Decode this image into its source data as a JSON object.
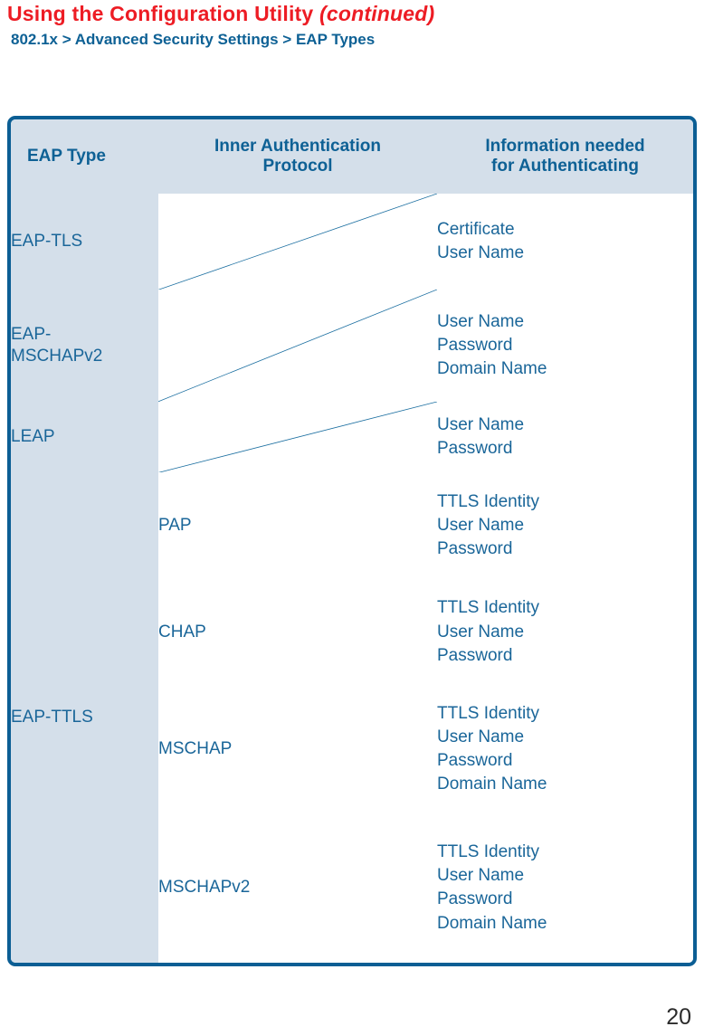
{
  "header": {
    "title_main": "Using the Configuration Utility",
    "title_continued": "(continued)",
    "subtitle": "802.1x > Advanced Security Settings > EAP Types",
    "title_color": "#ED1C24",
    "subtitle_color": "#0E6195"
  },
  "table": {
    "columns": [
      "EAP Type",
      "Inner Authentication Protocol",
      "Information needed for Authenticating"
    ],
    "columns_display": {
      "col1": "EAP Type",
      "col2_line1": "Inner Authentication",
      "col2_line2": "Protocol",
      "col3_line1": "Information needed",
      "col3_line2": "for Authenticating"
    },
    "border_color": "#0B5E94",
    "header_fill": "#D4DFEA",
    "left_cell_fill": "#D4DFEA",
    "text_color": "#1A6699",
    "rows": [
      {
        "eap_type_lines": [
          "EAP-TLS"
        ],
        "inner_protocol": "",
        "inner_protocol_na": true,
        "info": [
          "Certificate",
          "User Name"
        ]
      },
      {
        "eap_type_lines": [
          "EAP-",
          "MSCHAPv2"
        ],
        "inner_protocol": "",
        "inner_protocol_na": true,
        "info": [
          "User Name",
          "Password",
          "Domain Name"
        ]
      },
      {
        "eap_type_lines": [
          "LEAP"
        ],
        "inner_protocol": "",
        "inner_protocol_na": true,
        "info": [
          "User Name",
          "Password"
        ]
      },
      {
        "eap_type_lines": [
          "EAP-TTLS"
        ],
        "eap_type_rowspan": 4,
        "inner_protocol": "PAP",
        "inner_protocol_na": false,
        "info": [
          "TTLS Identity",
          "User Name",
          "Password"
        ]
      },
      {
        "inner_protocol": "CHAP",
        "inner_protocol_na": false,
        "info": [
          "TTLS Identity",
          "User Name",
          "Password"
        ]
      },
      {
        "inner_protocol": "MSCHAP",
        "inner_protocol_na": false,
        "info": [
          "TTLS Identity",
          "User Name",
          "Password",
          "Domain Name"
        ]
      },
      {
        "inner_protocol": "MSCHAPv2",
        "inner_protocol_na": false,
        "info": [
          "TTLS Identity",
          "User Name",
          "Password",
          "Domain Name"
        ]
      }
    ]
  },
  "footer": {
    "page_number": "20"
  }
}
